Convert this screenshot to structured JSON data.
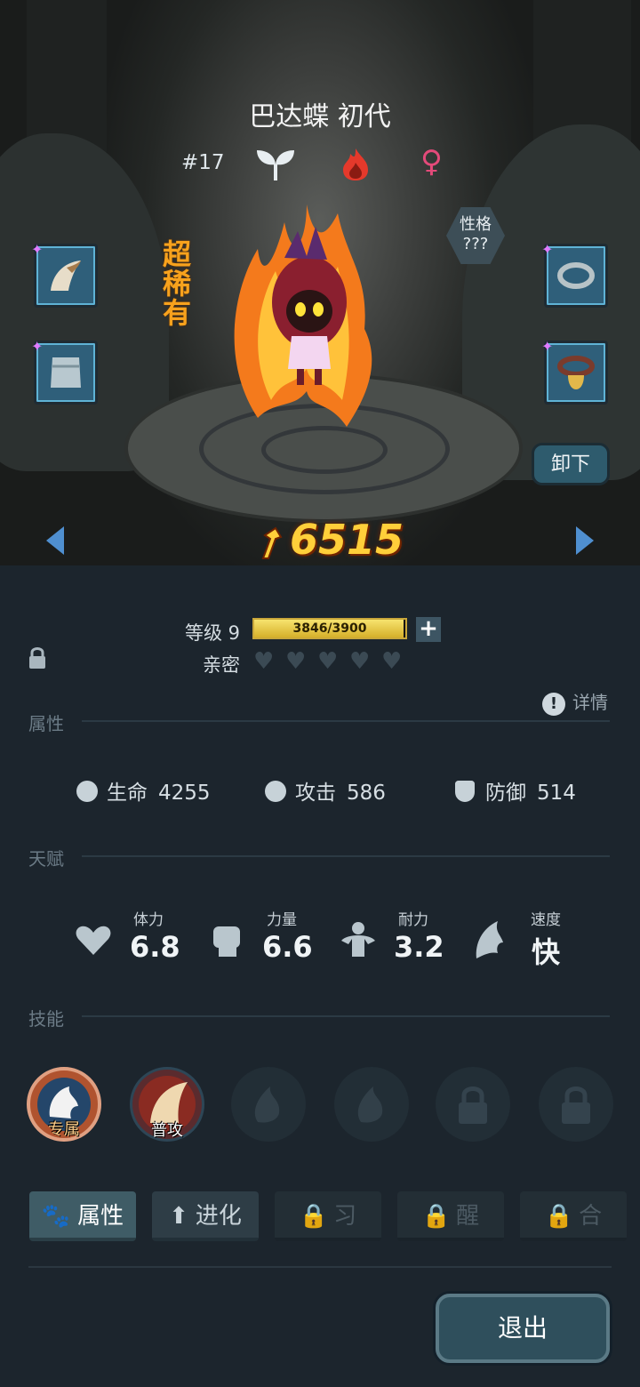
{
  "character": {
    "name": "巴达蝶 初代",
    "id_label": "#17",
    "rarity": "超稀有",
    "personality_label": "性格",
    "personality_value": "???",
    "power": "6515",
    "element_icon": "fire-icon",
    "type_icon": "sprout-icon",
    "gender_icon": "female-icon"
  },
  "equipment": {
    "left": [
      "tusk-item",
      "cloth-wrap-item"
    ],
    "right": [
      "ring-item",
      "bell-collar-item"
    ],
    "unequip_label": "卸下"
  },
  "level": {
    "label": "等级 9",
    "xp_text": "3846/3900",
    "xp_current": 3846,
    "xp_max": 3900,
    "intimacy_label": "亲密",
    "intimacy_hearts": 5,
    "intimacy_filled": 0
  },
  "sections": {
    "attributes": "属性",
    "talents": "天赋",
    "skills": "技能",
    "detail": "详情"
  },
  "stats": [
    {
      "label": "生命",
      "value": "4255",
      "icon": "heart-shield-icon"
    },
    {
      "label": "攻击",
      "value": "586",
      "icon": "sword-icon"
    },
    {
      "label": "防御",
      "value": "514",
      "icon": "shield-icon"
    }
  ],
  "talents": [
    {
      "label": "体力",
      "value": "6.8",
      "icon": "heart-icon"
    },
    {
      "label": "力量",
      "value": "6.6",
      "icon": "fist-icon"
    },
    {
      "label": "耐力",
      "value": "3.2",
      "icon": "muscle-icon"
    },
    {
      "label": "速度",
      "value": "快",
      "icon": "wing-icon"
    }
  ],
  "skills": [
    {
      "label": "专属",
      "state": "active"
    },
    {
      "label": "普攻",
      "state": "active"
    },
    {
      "label": "",
      "state": "empty"
    },
    {
      "label": "",
      "state": "empty"
    },
    {
      "label": "",
      "state": "locked"
    },
    {
      "label": "",
      "state": "locked"
    }
  ],
  "tabs": [
    {
      "label": "属性",
      "state": "active"
    },
    {
      "label": "进化",
      "state": "normal"
    },
    {
      "label": "习",
      "state": "locked"
    },
    {
      "label": "醒",
      "state": "locked"
    },
    {
      "label": "合",
      "state": "locked"
    }
  ],
  "exit_label": "退出"
}
